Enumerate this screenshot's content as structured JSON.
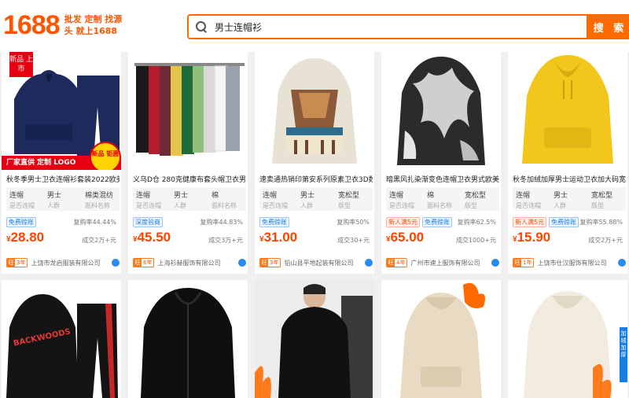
{
  "header": {
    "logo_text": "1688",
    "slogan": "批发 定制 找源头 就上1688",
    "search_value": "男士连帽衫",
    "search_button": "搜 索"
  },
  "products": [
    {
      "title": "秋冬季男士卫衣连帽衫套装2022欧美",
      "attrs": [
        {
          "v": "连帽",
          "k": "是否连帽"
        },
        {
          "v": "男士",
          "k": "人群"
        },
        {
          "v": "棉类混纺",
          "k": "面料名称"
        }
      ],
      "tags": [
        {
          "text": "免费赊账",
          "style": "blue"
        }
      ],
      "rate": "复购率44.44%",
      "currency": "¥",
      "price": "28.80",
      "sold": "成交2万+元",
      "years": "3年",
      "shop": "上饶市龙启服装有限公司",
      "corner_badge": "新品 上市",
      "promo_strip": "厂家直供 定制 LOGO",
      "promo_circle": "新品 钜惠"
    },
    {
      "title": "义乌D仓 280克健康布套头帽卫衣男",
      "attrs": [
        {
          "v": "连帽",
          "k": "是否连帽"
        },
        {
          "v": "男士",
          "k": "人群"
        },
        {
          "v": "棉",
          "k": "面料名称"
        }
      ],
      "tags": [
        {
          "text": "深度验商",
          "style": "blue"
        }
      ],
      "rate": "复购率44.83%",
      "currency": "¥",
      "price": "45.50",
      "sold": "成交3万+元",
      "years": "6年",
      "shop": "上海衫赫服饰有限公司"
    },
    {
      "title": "速卖通热销印第安系列原素卫衣3D数",
      "attrs": [
        {
          "v": "连帽",
          "k": "是否连帽"
        },
        {
          "v": "男士",
          "k": "人群"
        },
        {
          "v": "宽松型",
          "k": "版型"
        }
      ],
      "tags": [
        {
          "text": "免费赊账",
          "style": "blue"
        }
      ],
      "rate": "复购率50%",
      "currency": "¥",
      "price": "31.00",
      "sold": "成交30+元",
      "years": "3年",
      "shop": "铅山县平地起装有限公司"
    },
    {
      "title": "暗黑风扎染渐变色连帽卫衣男式欧美高",
      "attrs": [
        {
          "v": "连帽",
          "k": "是否连帽"
        },
        {
          "v": "棉",
          "k": "面料名称"
        },
        {
          "v": "宽松型",
          "k": "版型"
        }
      ],
      "tags": [
        {
          "text": "新人满5元",
          "style": "red"
        },
        {
          "text": "免费赊账",
          "style": "blue"
        }
      ],
      "rate": "复购率62.5%",
      "currency": "¥",
      "price": "65.00",
      "sold": "成交1000+元",
      "years": "4年",
      "shop": "广州市速上服饰有限公司"
    },
    {
      "title": "秋冬加绒加厚男士运动卫衣加大码宽松",
      "attrs": [
        {
          "v": "连帽",
          "k": "是否连帽"
        },
        {
          "v": "男士",
          "k": "人群"
        },
        {
          "v": "宽松型",
          "k": "版型"
        }
      ],
      "tags": [
        {
          "text": "新人满5元",
          "style": "red"
        },
        {
          "text": "免费赊账",
          "style": "blue"
        }
      ],
      "rate": "复购率55.88%",
      "currency": "¥",
      "price": "15.90",
      "sold": "成交2万+元",
      "years": "1年",
      "shop": "上饶市仕汉服饰有限公司",
      "side_strip": "加绒加厚"
    }
  ],
  "row2": [
    {
      "graphic_text": "BACKWOODS"
    },
    {},
    {},
    {},
    {}
  ],
  "colors": {
    "brand": "#ff5500",
    "search_accent": "#ff6a00",
    "price": "#ff4400"
  }
}
